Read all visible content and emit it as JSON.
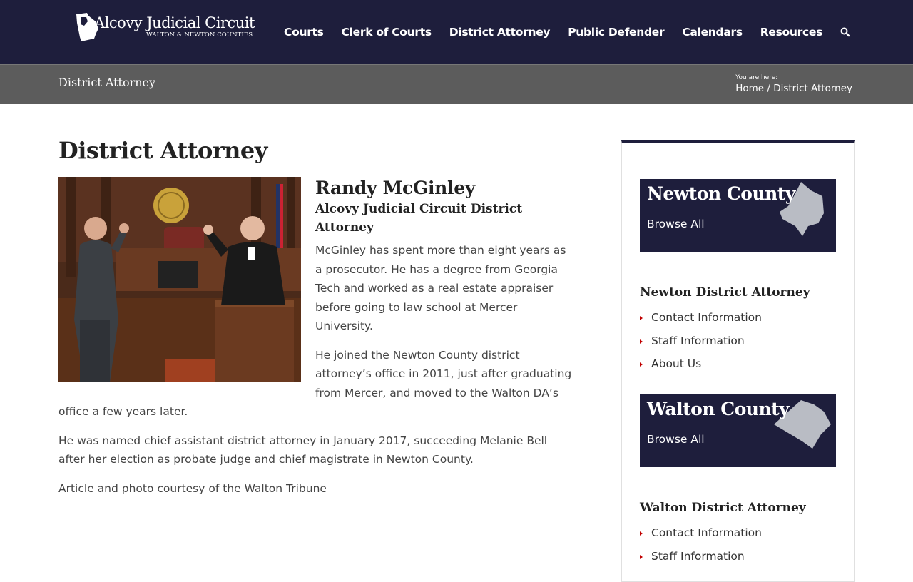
{
  "header": {
    "logo_title": "Alcovy Judicial Circuit",
    "logo_subtitle": "WALTON & NEWTON COUNTIES",
    "nav": [
      "Courts",
      "Clerk of Courts",
      "District Attorney",
      "Public Defender",
      "Calendars",
      "Resources"
    ],
    "search_icon": "search-icon"
  },
  "title_bar": {
    "heading": "District Attorney",
    "breadcrumb_label": "You are here:",
    "breadcrumb_home": "Home",
    "breadcrumb_current": "/ District Attorney"
  },
  "main": {
    "page_title": "District Attorney",
    "person_name": "Randy McGinley",
    "person_title": "Alcovy Judicial Circuit District Attorney",
    "paragraphs": [
      "McGinley has spent more than eight years as a prosecutor. He has a degree from Georgia Tech and worked as a real estate appraiser before going to law school at Mercer University.",
      "He joined the Newton County district attorney’s office in 2011, just after graduating from Mercer, and moved to the Walton DA’s office a few years later.",
      "He was named chief assistant district attorney in January 2017, succeeding Melanie Bell after her election as probate judge and chief magistrate in Newton County.",
      "Article and photo courtesy of the Walton Tribune"
    ]
  },
  "sidebar": {
    "newton_card": {
      "name": "Newton County",
      "browse": "Browse All"
    },
    "newton_widget": {
      "title": "Newton District Attorney",
      "links": [
        "Contact Information",
        "Staff Information",
        "About Us"
      ]
    },
    "walton_card": {
      "name": "Walton County",
      "browse": "Browse All"
    },
    "walton_widget": {
      "title": "Walton District Attorney",
      "links": [
        "Contact Information",
        "Staff Information"
      ]
    }
  },
  "colors": {
    "navy": "#1e1e3c",
    "title_bar": "#5c5c5c",
    "bullet_red": "#c00000"
  }
}
